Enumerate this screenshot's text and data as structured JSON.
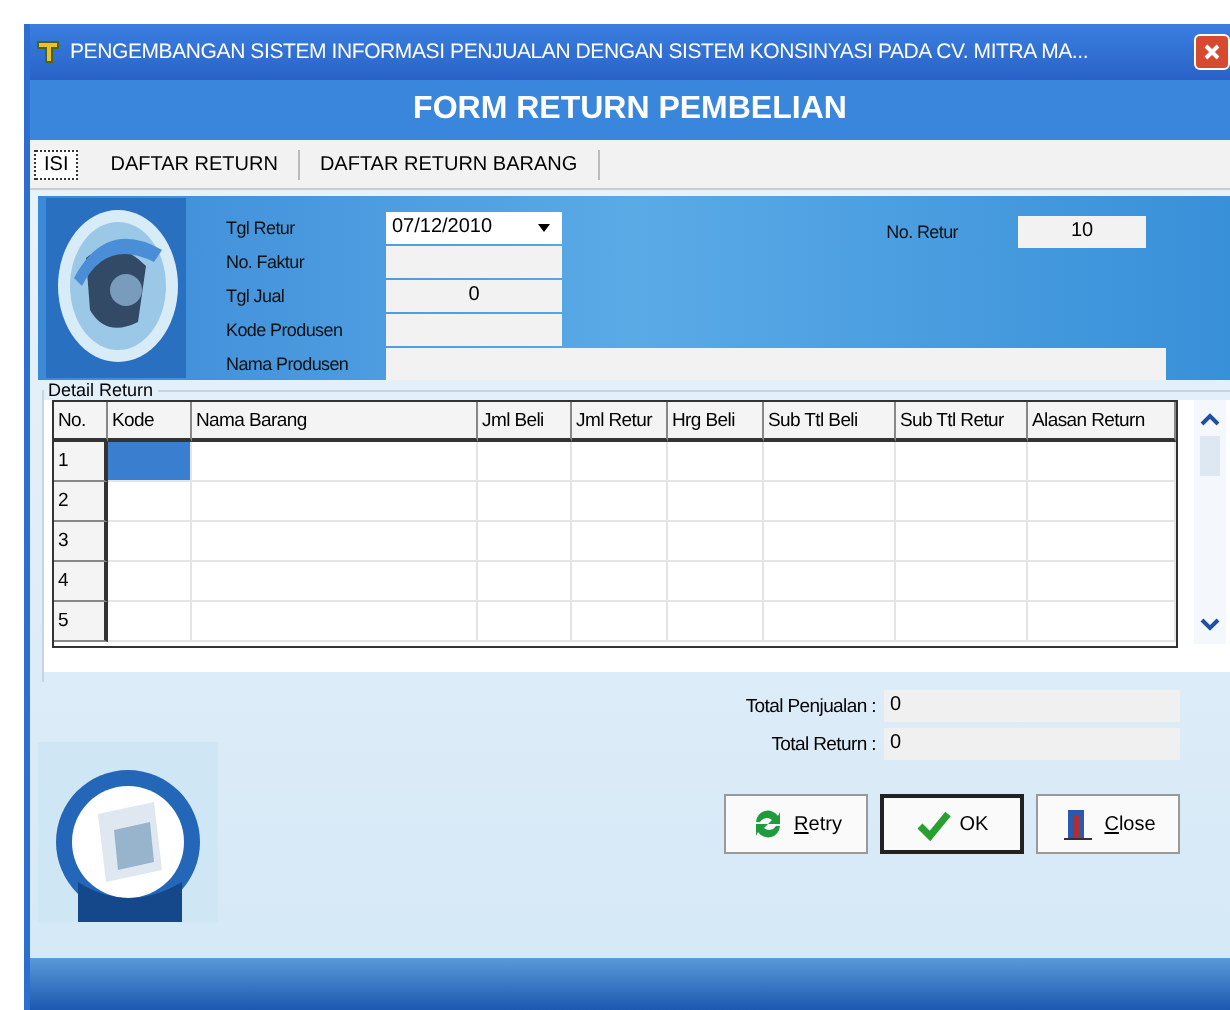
{
  "window": {
    "title": "PENGEMBANGAN SISTEM INFORMASI PENJUALAN DENGAN SISTEM KONSINYASI PADA CV. MITRA MA..."
  },
  "form_title": "FORM RETURN PEMBELIAN",
  "tabs": [
    {
      "label": "ISI",
      "selected": true
    },
    {
      "label": "DAFTAR RETURN",
      "selected": false
    },
    {
      "label": "DAFTAR RETURN BARANG",
      "selected": false
    }
  ],
  "fields": [
    {
      "label": "Tgl Retur",
      "value": "07/12/2010",
      "kind": "date"
    },
    {
      "label": "No. Faktur",
      "kind": "text"
    },
    {
      "label": "Tgl Jual",
      "value": "0",
      "kind": "text"
    },
    {
      "label": "Kode Produsen",
      "kind": "text"
    },
    {
      "label": "Nama Produsen",
      "kind": "wide"
    }
  ],
  "no_retur": {
    "label": "No. Retur",
    "value": "10"
  },
  "detail": {
    "title": "Detail Return",
    "columns": [
      "No.",
      "Kode",
      "Nama Barang",
      "Jml Beli",
      "Jml Retur",
      "Hrg Beli",
      "Sub Ttl Beli",
      "Sub Ttl Retur",
      "Alasan Return"
    ],
    "rows": [
      {
        "number": "1",
        "selected": true
      },
      {
        "number": "2",
        "selected": false
      },
      {
        "number": "3",
        "selected": false
      },
      {
        "number": "4",
        "selected": false
      },
      {
        "number": "5",
        "selected": false
      }
    ]
  },
  "totals": [
    {
      "label": "Total Penjualan :",
      "value": "0"
    },
    {
      "label": "Total Return :",
      "value": "0"
    }
  ],
  "buttons": [
    {
      "label": "Retry",
      "kind": "retry",
      "focused": false
    },
    {
      "label": "OK",
      "kind": "ok",
      "focused": true
    },
    {
      "label": "Close",
      "kind": "close",
      "focused": false
    }
  ]
}
